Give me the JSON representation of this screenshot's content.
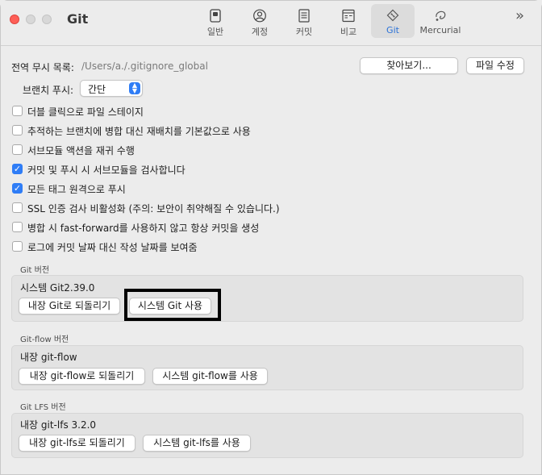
{
  "window": {
    "title": "Git"
  },
  "toolbar": {
    "items": [
      {
        "label": "일반",
        "icon": "general-switch-icon"
      },
      {
        "label": "계정",
        "icon": "account-icon"
      },
      {
        "label": "커밋",
        "icon": "commit-document-icon"
      },
      {
        "label": "비교",
        "icon": "diff-window-icon"
      },
      {
        "label": "Git",
        "icon": "git-diamond-icon",
        "active": true
      },
      {
        "label": "Mercurial",
        "icon": "mercurial-icon"
      }
    ],
    "overflow": "»"
  },
  "global_ignore": {
    "label": "전역 무시 목록:",
    "path": "/Users/a./.gitignore_global",
    "browse_button": "찾아보기...",
    "edit_button": "파일 수정"
  },
  "branch_push": {
    "label": "브랜치 푸시:",
    "value": "간단"
  },
  "checkboxes": [
    {
      "label": "더블 클릭으로 파일 스테이지",
      "checked": false
    },
    {
      "label": "추적하는 브랜치에 병합 대신 재배치를 기본값으로 사용",
      "checked": false
    },
    {
      "label": "서브모듈 액션을 재귀 수행",
      "checked": false
    },
    {
      "label": "커밋 및 푸시 시 서브모듈을 검사합니다",
      "checked": true
    },
    {
      "label": "모든 태그 원격으로 푸시",
      "checked": true
    },
    {
      "label": "SSL 인증 검사 비활성화 (주의: 보안이 취약해질 수 있습니다.)",
      "checked": false
    },
    {
      "label": "병합 시 fast-forward를 사용하지 않고 항상 커밋을 생성",
      "checked": false
    },
    {
      "label": "로그에 커밋 날짜 대신 작성 날짜를 보여줌",
      "checked": false
    }
  ],
  "git_version": {
    "section": "Git 버전",
    "current": "시스템 Git2.39.0",
    "embedded_button": "내장 Git로 되돌리기",
    "system_button": "시스템 Git 사용"
  },
  "gitflow_version": {
    "section": "Git-flow 버전",
    "current": "내장 git-flow",
    "embedded_button": "내장 git-flow로 되돌리기",
    "system_button": "시스템 git-flow를 사용"
  },
  "gitlfs_version": {
    "section": "Git LFS 버전",
    "current": "내장 git-lfs 3.2.0",
    "embedded_button": "내장 git-lfs로 되돌리기",
    "system_button": "시스템 git-lfs를 사용"
  },
  "colors": {
    "accent": "#2f7df6",
    "close": "#fe5f57",
    "highlight_border": "#000000"
  }
}
